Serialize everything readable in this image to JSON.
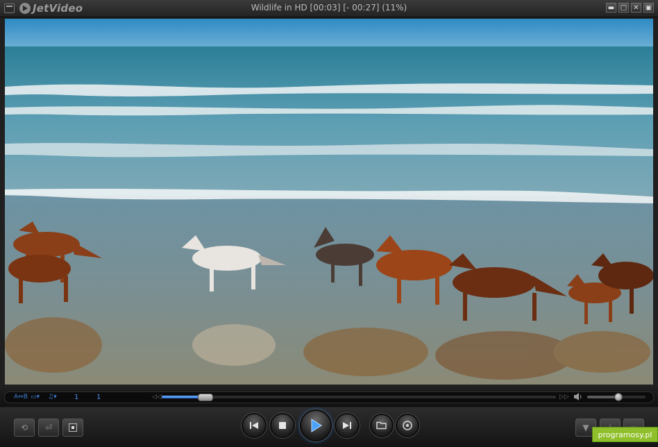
{
  "app": {
    "brand": "JetVideo",
    "window_title": "Wildlife in HD [00:03] [- 00:27] (11%)"
  },
  "window_buttons": [
    {
      "name": "minimize",
      "glyph": "▬"
    },
    {
      "name": "restore",
      "glyph": "□"
    },
    {
      "name": "close",
      "glyph": "✕"
    },
    {
      "name": "extra",
      "glyph": "▣"
    }
  ],
  "video": {
    "description": "video frame",
    "progress": 0.11
  },
  "seek": {
    "ab_label": "A⇔B",
    "subtitle_label": "▭▾",
    "audio_label": "♫▾",
    "counter_1": "1",
    "counter_2": "1",
    "prev_glyph": "◁◁",
    "next_glyph": "▷▷",
    "volume": 0.52
  },
  "controls": {
    "rotate_glyph": "⟲",
    "exit_glyph": "⏎",
    "menu_glyph": "▼",
    "info_glyph": "i",
    "full_glyph": "▭"
  },
  "watermark": "programosy.pl",
  "colors": {
    "accent": "#2d6fd0",
    "bg": "#202020"
  }
}
